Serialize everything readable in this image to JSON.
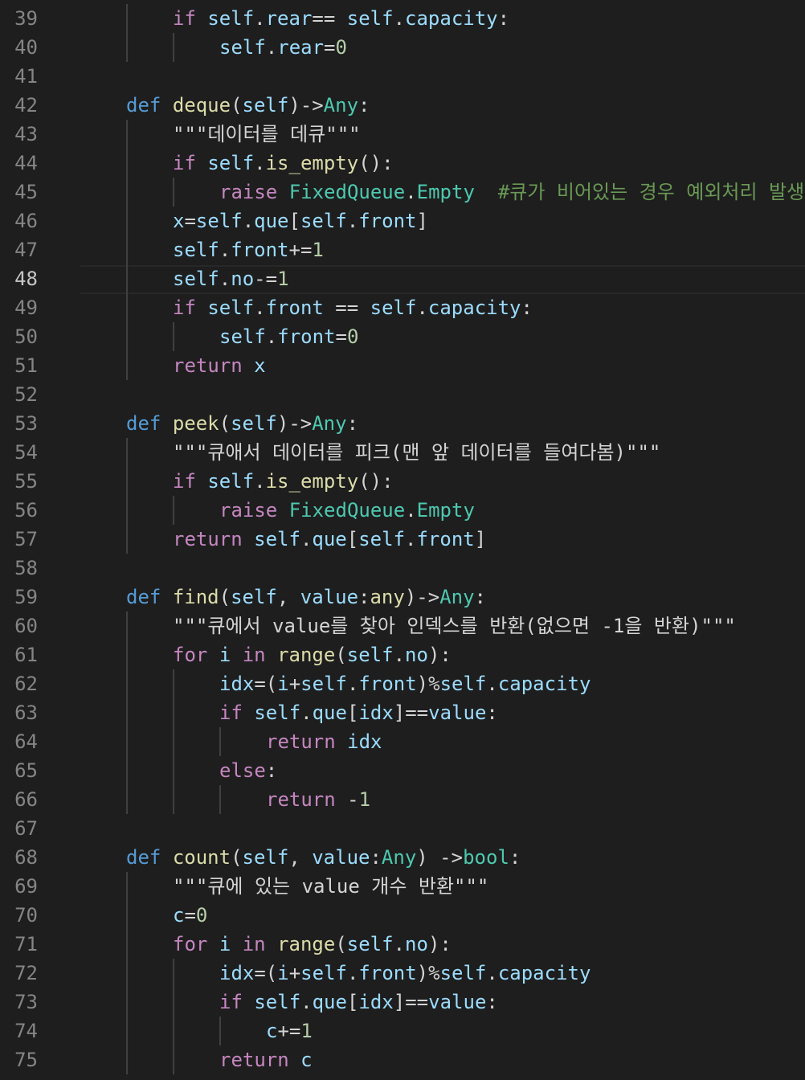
{
  "editor": {
    "active_line": 48,
    "colors": {
      "background": "#1e1e1e",
      "line_number": "#858585",
      "keyword": "#569cd6",
      "control": "#c586c0",
      "function": "#dcdcaa",
      "variable": "#9cdcfe",
      "type": "#4ec9b0",
      "number": "#b5cea8",
      "comment": "#6a9955",
      "text": "#d4d4d4"
    },
    "lines": [
      {
        "n": 39,
        "indent": 2,
        "tokens": [
          [
            "ctl",
            "if"
          ],
          [
            "op",
            " "
          ],
          [
            "var",
            "self"
          ],
          [
            "op",
            "."
          ],
          [
            "var",
            "rear"
          ],
          [
            "op",
            "== "
          ],
          [
            "var",
            "self"
          ],
          [
            "op",
            "."
          ],
          [
            "var",
            "capacity"
          ],
          [
            "op",
            ":"
          ]
        ]
      },
      {
        "n": 40,
        "indent": 3,
        "tokens": [
          [
            "var",
            "self"
          ],
          [
            "op",
            "."
          ],
          [
            "var",
            "rear"
          ],
          [
            "op",
            "="
          ],
          [
            "num",
            "0"
          ]
        ]
      },
      {
        "n": 41,
        "indent": 0,
        "tokens": []
      },
      {
        "n": 42,
        "indent": 1,
        "tokens": [
          [
            "kw",
            "def"
          ],
          [
            "op",
            " "
          ],
          [
            "fn",
            "deque"
          ],
          [
            "punc",
            "("
          ],
          [
            "var",
            "self"
          ],
          [
            "punc",
            ")"
          ],
          [
            "op",
            "->"
          ],
          [
            "type",
            "Any"
          ],
          [
            "op",
            ":"
          ]
        ]
      },
      {
        "n": 43,
        "indent": 2,
        "tokens": [
          [
            "doc",
            "\"\"\"데이터를 데큐\"\"\""
          ]
        ]
      },
      {
        "n": 44,
        "indent": 2,
        "tokens": [
          [
            "ctl",
            "if"
          ],
          [
            "op",
            " "
          ],
          [
            "var",
            "self"
          ],
          [
            "op",
            "."
          ],
          [
            "fn",
            "is_empty"
          ],
          [
            "punc",
            "():"
          ]
        ]
      },
      {
        "n": 45,
        "indent": 3,
        "tokens": [
          [
            "ctl",
            "raise"
          ],
          [
            "op",
            " "
          ],
          [
            "type",
            "FixedQueue"
          ],
          [
            "op",
            "."
          ],
          [
            "type",
            "Empty"
          ],
          [
            "op",
            "  "
          ],
          [
            "com",
            "#큐가 비어있는 경우 예외처리 발생"
          ]
        ]
      },
      {
        "n": 46,
        "indent": 2,
        "tokens": [
          [
            "var",
            "x"
          ],
          [
            "op",
            "="
          ],
          [
            "var",
            "self"
          ],
          [
            "op",
            "."
          ],
          [
            "var",
            "que"
          ],
          [
            "punc",
            "["
          ],
          [
            "var",
            "self"
          ],
          [
            "op",
            "."
          ],
          [
            "var",
            "front"
          ],
          [
            "punc",
            "]"
          ]
        ]
      },
      {
        "n": 47,
        "indent": 2,
        "tokens": [
          [
            "var",
            "self"
          ],
          [
            "op",
            "."
          ],
          [
            "var",
            "front"
          ],
          [
            "op",
            "+="
          ],
          [
            "num",
            "1"
          ]
        ]
      },
      {
        "n": 48,
        "indent": 2,
        "tokens": [
          [
            "var",
            "self"
          ],
          [
            "op",
            "."
          ],
          [
            "var",
            "no"
          ],
          [
            "op",
            "-="
          ],
          [
            "num",
            "1"
          ]
        ]
      },
      {
        "n": 49,
        "indent": 2,
        "tokens": [
          [
            "ctl",
            "if"
          ],
          [
            "op",
            " "
          ],
          [
            "var",
            "self"
          ],
          [
            "op",
            "."
          ],
          [
            "var",
            "front"
          ],
          [
            "op",
            " == "
          ],
          [
            "var",
            "self"
          ],
          [
            "op",
            "."
          ],
          [
            "var",
            "capacity"
          ],
          [
            "op",
            ":"
          ]
        ]
      },
      {
        "n": 50,
        "indent": 3,
        "tokens": [
          [
            "var",
            "self"
          ],
          [
            "op",
            "."
          ],
          [
            "var",
            "front"
          ],
          [
            "op",
            "="
          ],
          [
            "num",
            "0"
          ]
        ]
      },
      {
        "n": 51,
        "indent": 2,
        "tokens": [
          [
            "ctl",
            "return"
          ],
          [
            "op",
            " "
          ],
          [
            "var",
            "x"
          ]
        ]
      },
      {
        "n": 52,
        "indent": 0,
        "tokens": []
      },
      {
        "n": 53,
        "indent": 1,
        "tokens": [
          [
            "kw",
            "def"
          ],
          [
            "op",
            " "
          ],
          [
            "fn",
            "peek"
          ],
          [
            "punc",
            "("
          ],
          [
            "var",
            "self"
          ],
          [
            "punc",
            ")"
          ],
          [
            "op",
            "->"
          ],
          [
            "type",
            "Any"
          ],
          [
            "op",
            ":"
          ]
        ]
      },
      {
        "n": 54,
        "indent": 2,
        "tokens": [
          [
            "doc",
            "\"\"\"큐애서 데이터를 피크(맨 앞 데이터를 들여다봄)\"\"\""
          ]
        ]
      },
      {
        "n": 55,
        "indent": 2,
        "tokens": [
          [
            "ctl",
            "if"
          ],
          [
            "op",
            " "
          ],
          [
            "var",
            "self"
          ],
          [
            "op",
            "."
          ],
          [
            "fn",
            "is_empty"
          ],
          [
            "punc",
            "():"
          ]
        ]
      },
      {
        "n": 56,
        "indent": 3,
        "tokens": [
          [
            "ctl",
            "raise"
          ],
          [
            "op",
            " "
          ],
          [
            "type",
            "FixedQueue"
          ],
          [
            "op",
            "."
          ],
          [
            "type",
            "Empty"
          ]
        ]
      },
      {
        "n": 57,
        "indent": 2,
        "tokens": [
          [
            "ctl",
            "return"
          ],
          [
            "op",
            " "
          ],
          [
            "var",
            "self"
          ],
          [
            "op",
            "."
          ],
          [
            "var",
            "que"
          ],
          [
            "punc",
            "["
          ],
          [
            "var",
            "self"
          ],
          [
            "op",
            "."
          ],
          [
            "var",
            "front"
          ],
          [
            "punc",
            "]"
          ]
        ]
      },
      {
        "n": 58,
        "indent": 0,
        "tokens": []
      },
      {
        "n": 59,
        "indent": 1,
        "tokens": [
          [
            "kw",
            "def"
          ],
          [
            "op",
            " "
          ],
          [
            "fn",
            "find"
          ],
          [
            "punc",
            "("
          ],
          [
            "var",
            "self"
          ],
          [
            "punc",
            ", "
          ],
          [
            "var",
            "value"
          ],
          [
            "op",
            ":"
          ],
          [
            "fn",
            "any"
          ],
          [
            "punc",
            ")"
          ],
          [
            "op",
            "->"
          ],
          [
            "type",
            "Any"
          ],
          [
            "op",
            ":"
          ]
        ]
      },
      {
        "n": 60,
        "indent": 2,
        "tokens": [
          [
            "doc",
            "\"\"\"큐에서 value를 찾아 인덱스를 반환(없으면 -1을 반환)\"\"\""
          ]
        ]
      },
      {
        "n": 61,
        "indent": 2,
        "tokens": [
          [
            "ctl",
            "for"
          ],
          [
            "op",
            " "
          ],
          [
            "var",
            "i"
          ],
          [
            "op",
            " "
          ],
          [
            "ctl",
            "in"
          ],
          [
            "op",
            " "
          ],
          [
            "fn",
            "range"
          ],
          [
            "punc",
            "("
          ],
          [
            "var",
            "self"
          ],
          [
            "op",
            "."
          ],
          [
            "var",
            "no"
          ],
          [
            "punc",
            "):"
          ]
        ]
      },
      {
        "n": 62,
        "indent": 3,
        "tokens": [
          [
            "var",
            "idx"
          ],
          [
            "op",
            "=("
          ],
          [
            "var",
            "i"
          ],
          [
            "op",
            "+"
          ],
          [
            "var",
            "self"
          ],
          [
            "op",
            "."
          ],
          [
            "var",
            "front"
          ],
          [
            "op",
            ")%"
          ],
          [
            "var",
            "self"
          ],
          [
            "op",
            "."
          ],
          [
            "var",
            "capacity"
          ]
        ]
      },
      {
        "n": 63,
        "indent": 3,
        "tokens": [
          [
            "ctl",
            "if"
          ],
          [
            "op",
            " "
          ],
          [
            "var",
            "self"
          ],
          [
            "op",
            "."
          ],
          [
            "var",
            "que"
          ],
          [
            "punc",
            "["
          ],
          [
            "var",
            "idx"
          ],
          [
            "punc",
            "]"
          ],
          [
            "op",
            "=="
          ],
          [
            "var",
            "value"
          ],
          [
            "op",
            ":"
          ]
        ]
      },
      {
        "n": 64,
        "indent": 4,
        "tokens": [
          [
            "ctl",
            "return"
          ],
          [
            "op",
            " "
          ],
          [
            "var",
            "idx"
          ]
        ]
      },
      {
        "n": 65,
        "indent": 3,
        "tokens": [
          [
            "ctl",
            "else"
          ],
          [
            "op",
            ":"
          ]
        ]
      },
      {
        "n": 66,
        "indent": 4,
        "tokens": [
          [
            "ctl",
            "return"
          ],
          [
            "op",
            " -"
          ],
          [
            "num",
            "1"
          ]
        ]
      },
      {
        "n": 67,
        "indent": 0,
        "tokens": []
      },
      {
        "n": 68,
        "indent": 1,
        "tokens": [
          [
            "kw",
            "def"
          ],
          [
            "op",
            " "
          ],
          [
            "fn",
            "count"
          ],
          [
            "punc",
            "("
          ],
          [
            "var",
            "self"
          ],
          [
            "punc",
            ", "
          ],
          [
            "var",
            "value"
          ],
          [
            "op",
            ":"
          ],
          [
            "type",
            "Any"
          ],
          [
            "punc",
            ")"
          ],
          [
            "op",
            " ->"
          ],
          [
            "type",
            "bool"
          ],
          [
            "op",
            ":"
          ]
        ]
      },
      {
        "n": 69,
        "indent": 2,
        "tokens": [
          [
            "doc",
            "\"\"\"큐에 있는 value 개수 반환\"\"\""
          ]
        ]
      },
      {
        "n": 70,
        "indent": 2,
        "tokens": [
          [
            "var",
            "c"
          ],
          [
            "op",
            "="
          ],
          [
            "num",
            "0"
          ]
        ]
      },
      {
        "n": 71,
        "indent": 2,
        "tokens": [
          [
            "ctl",
            "for"
          ],
          [
            "op",
            " "
          ],
          [
            "var",
            "i"
          ],
          [
            "op",
            " "
          ],
          [
            "ctl",
            "in"
          ],
          [
            "op",
            " "
          ],
          [
            "fn",
            "range"
          ],
          [
            "punc",
            "("
          ],
          [
            "var",
            "self"
          ],
          [
            "op",
            "."
          ],
          [
            "var",
            "no"
          ],
          [
            "punc",
            "):"
          ]
        ]
      },
      {
        "n": 72,
        "indent": 3,
        "tokens": [
          [
            "var",
            "idx"
          ],
          [
            "op",
            "=("
          ],
          [
            "var",
            "i"
          ],
          [
            "op",
            "+"
          ],
          [
            "var",
            "self"
          ],
          [
            "op",
            "."
          ],
          [
            "var",
            "front"
          ],
          [
            "op",
            ")%"
          ],
          [
            "var",
            "self"
          ],
          [
            "op",
            "."
          ],
          [
            "var",
            "capacity"
          ]
        ]
      },
      {
        "n": 73,
        "indent": 3,
        "tokens": [
          [
            "ctl",
            "if"
          ],
          [
            "op",
            " "
          ],
          [
            "var",
            "self"
          ],
          [
            "op",
            "."
          ],
          [
            "var",
            "que"
          ],
          [
            "punc",
            "["
          ],
          [
            "var",
            "idx"
          ],
          [
            "punc",
            "]"
          ],
          [
            "op",
            "=="
          ],
          [
            "var",
            "value"
          ],
          [
            "op",
            ":"
          ]
        ]
      },
      {
        "n": 74,
        "indent": 4,
        "tokens": [
          [
            "var",
            "c"
          ],
          [
            "op",
            "+="
          ],
          [
            "num",
            "1"
          ]
        ]
      },
      {
        "n": 75,
        "indent": 3,
        "tokens": [
          [
            "ctl",
            "return"
          ],
          [
            "op",
            " "
          ],
          [
            "var",
            "c"
          ]
        ]
      }
    ]
  }
}
